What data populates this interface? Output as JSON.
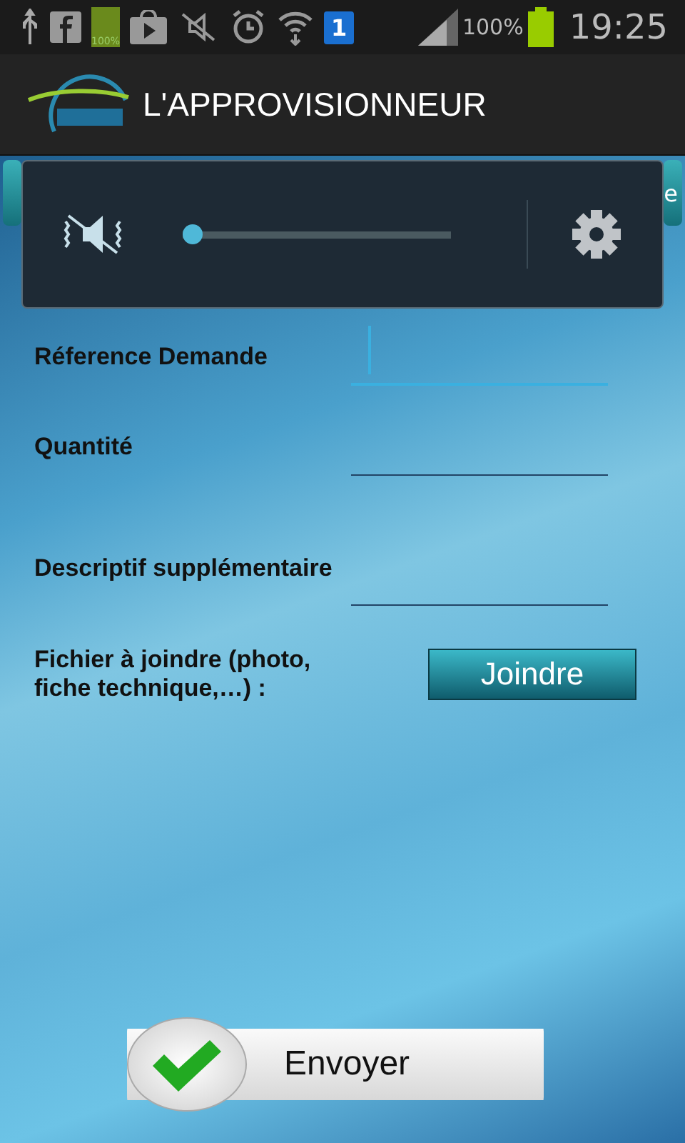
{
  "status_bar": {
    "battery_icon_label": "100%",
    "sim_badge": "1",
    "battery_percent": "100%",
    "time": "19:25"
  },
  "action_bar": {
    "title": "L'APPROVISIONNEUR"
  },
  "tabs": [
    {
      "label": "e"
    }
  ],
  "volume_panel": {
    "muted": true,
    "level": 0
  },
  "form": {
    "fields": [
      {
        "label": "Réference Demande",
        "focused": true
      },
      {
        "label": "Quantité",
        "focused": false
      },
      {
        "label": "Descriptif supplémentaire",
        "focused": false
      }
    ],
    "attachment": {
      "label": "Fichier à joindre (photo, fiche technique,…) :",
      "button": "Joindre"
    }
  },
  "send_button": "Envoyer"
}
